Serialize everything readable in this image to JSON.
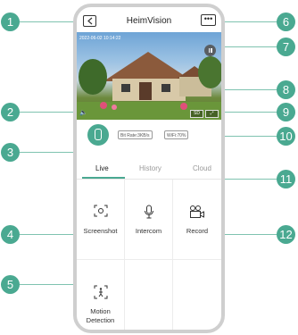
{
  "header": {
    "title": "HeimVision"
  },
  "video": {
    "timestamp": "2022-06-02   10:14:22",
    "hd_label": "SD"
  },
  "status": {
    "bitrate": "Bit Rate:3KB/s",
    "wifi": "WiFi:70%"
  },
  "tabs": [
    {
      "label": "Live"
    },
    {
      "label": "History"
    },
    {
      "label": "Cloud"
    }
  ],
  "actions": [
    {
      "label": "Screenshot"
    },
    {
      "label": "Intercom"
    },
    {
      "label": "Record"
    },
    {
      "label": "Motion\nDetection"
    }
  ],
  "callouts": [
    "1",
    "2",
    "3",
    "4",
    "5",
    "6",
    "7",
    "8",
    "9",
    "10",
    "11",
    "12"
  ],
  "colors": {
    "accent": "#4aa991"
  }
}
